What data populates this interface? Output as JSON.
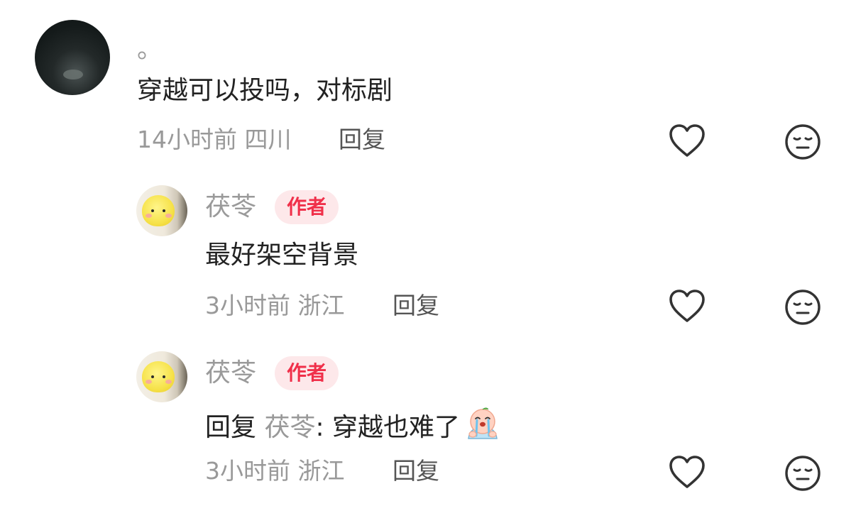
{
  "comments": [
    {
      "username": "。",
      "content": "穿越可以投吗，对标剧",
      "time": "14小时前",
      "location": "四川",
      "reply_label": "回复",
      "like_icon": "heart-icon",
      "dislike_icon": "neutral-face-icon"
    }
  ],
  "replies": [
    {
      "username": "茯苓",
      "badge": "作者",
      "content": "最好架空背景",
      "time": "3小时前",
      "location": "浙江",
      "reply_label": "回复",
      "like_icon": "heart-icon",
      "dislike_icon": "neutral-face-icon"
    },
    {
      "username": "茯苓",
      "badge": "作者",
      "reply_prefix": "回复",
      "quoted_user": "茯苓",
      "content_after": ": 穿越也难了",
      "emoji": "crying-emoji-icon",
      "time": "3小时前",
      "location": "浙江",
      "reply_label": "回复",
      "like_icon": "heart-icon",
      "dislike_icon": "neutral-face-icon"
    }
  ]
}
